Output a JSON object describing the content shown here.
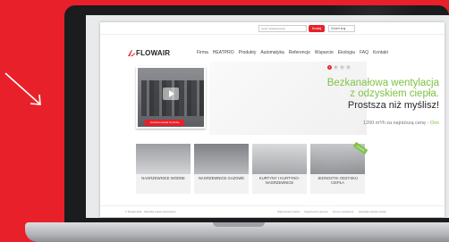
{
  "site": {
    "logo": "FLOWAIR",
    "search": {
      "placeholder": "wpisz szukaną frazę",
      "button": "Szukaj"
    },
    "language": "Zmień kraj",
    "nav": [
      "Firma",
      "HEATPRO",
      "Produkty",
      "Automatyka",
      "Referencje",
      "Wsparcie",
      "Ekologia",
      "FAQ",
      "Kontakt"
    ],
    "slider_dots": [
      "1",
      "2",
      "3",
      "4"
    ],
    "hero": {
      "video_button": "Uruchom kanał YouTube",
      "line1": "Bezkanałowa wentylacja",
      "line2": "z odzyskiem ciepła.",
      "line3": "Prostsza niż myślisz!",
      "price_prefix": "1200 m³/h za najniższą cenę - ",
      "price_link": "Oxo"
    },
    "products": [
      {
        "label": "NAGRZEWNICE WODNE"
      },
      {
        "label": "NAGRZEWNICE GAZOWE"
      },
      {
        "label": "KURTYNY I KURTYNO-NAGRZEWNICE"
      },
      {
        "label": "JEDNOSTKI ODZYSKU CIEPŁA",
        "badge": "nowość"
      }
    ],
    "footer": {
      "left": "© Flowair 2011 · Wszelkie prawa zastrzeżone",
      "links": [
        "Nagrzewnice wodne",
        "Nagrzewnice gazowe",
        "Kurtyny powietrzne",
        "Jednostki odzysku ciepła"
      ]
    }
  },
  "colors": {
    "brand_red": "#e8202a",
    "accent_green": "#7cc142"
  }
}
